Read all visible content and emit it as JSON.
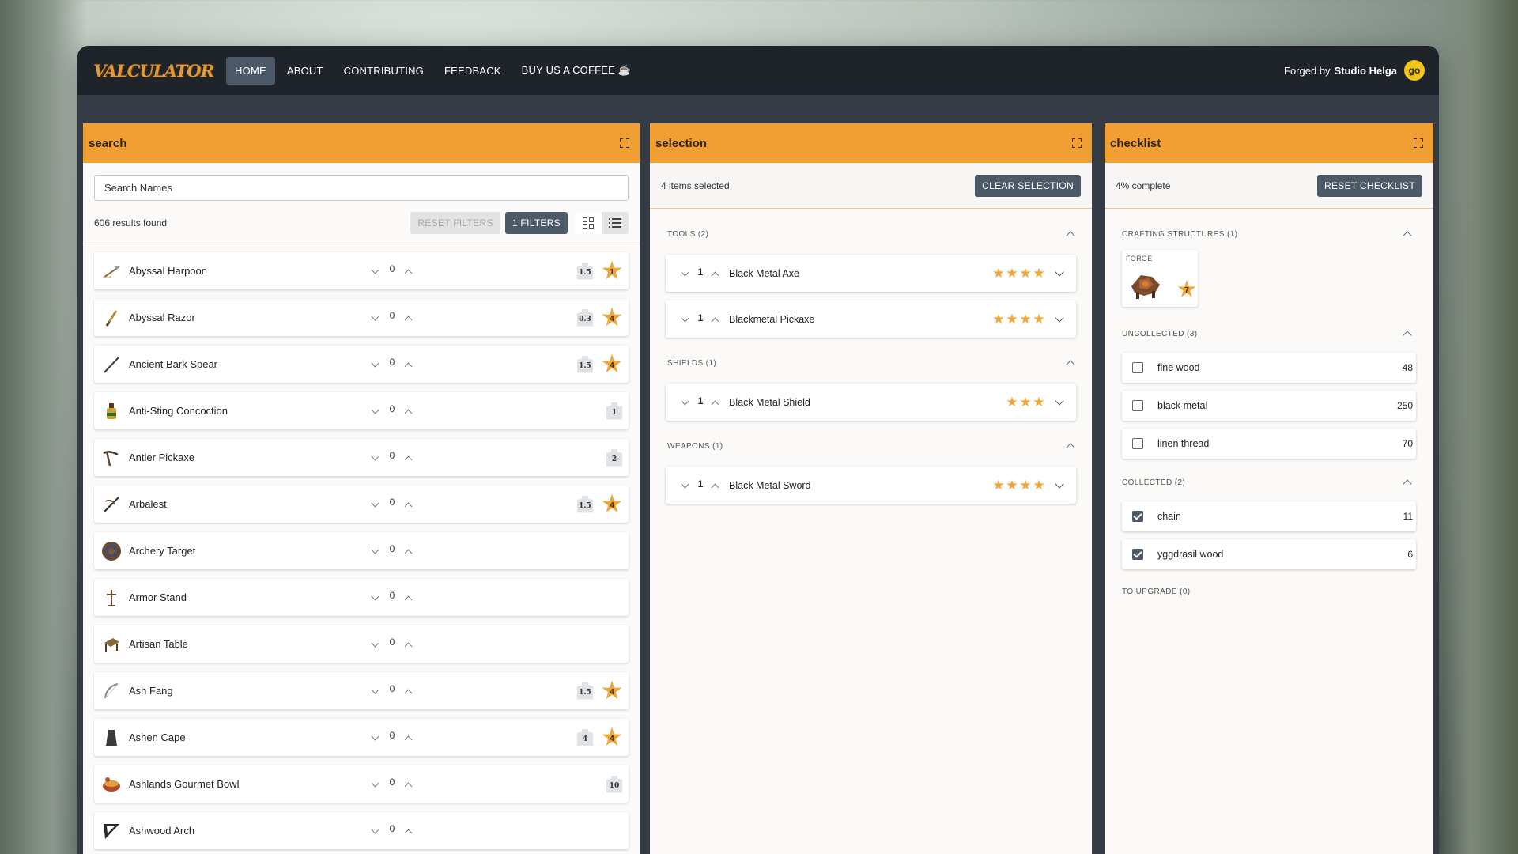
{
  "app": {
    "logo": "VALCULATOR"
  },
  "nav": {
    "items": [
      {
        "label": "HOME",
        "active": true
      },
      {
        "label": "ABOUT",
        "active": false
      },
      {
        "label": "CONTRIBUTING",
        "active": false
      },
      {
        "label": "FEEDBACK",
        "active": false
      },
      {
        "label": "BUY US A COFFEE ☕",
        "active": false
      }
    ],
    "forged_prefix": "Forged by",
    "forged_by": "Studio Helga",
    "badge": "go"
  },
  "search": {
    "title": "search",
    "placeholder": "Search Names",
    "results": "606 results found",
    "reset_filters": "RESET FILTERS",
    "filters": "1 FILTERS",
    "items": [
      {
        "name": "Abyssal Harpoon",
        "qty": "0",
        "weight": "1.5",
        "star": "1",
        "icon": "harpoon-icon"
      },
      {
        "name": "Abyssal Razor",
        "qty": "0",
        "weight": "0.3",
        "star": "4",
        "icon": "razor-icon"
      },
      {
        "name": "Ancient Bark Spear",
        "qty": "0",
        "weight": "1.5",
        "star": "4",
        "icon": "spear-icon"
      },
      {
        "name": "Anti-Sting Concoction",
        "qty": "0",
        "weight": "1",
        "star": "",
        "icon": "potion-icon"
      },
      {
        "name": "Antler Pickaxe",
        "qty": "0",
        "weight": "2",
        "star": "",
        "icon": "pickaxe-icon"
      },
      {
        "name": "Arbalest",
        "qty": "0",
        "weight": "1.5",
        "star": "4",
        "icon": "crossbow-icon"
      },
      {
        "name": "Archery Target",
        "qty": "0",
        "weight": "",
        "star": "",
        "icon": "target-icon"
      },
      {
        "name": "Armor Stand",
        "qty": "0",
        "weight": "",
        "star": "",
        "icon": "armor-stand-icon"
      },
      {
        "name": "Artisan Table",
        "qty": "0",
        "weight": "",
        "star": "",
        "icon": "table-icon"
      },
      {
        "name": "Ash Fang",
        "qty": "0",
        "weight": "1.5",
        "star": "4",
        "icon": "bow-icon"
      },
      {
        "name": "Ashen Cape",
        "qty": "0",
        "weight": "4",
        "star": "4",
        "icon": "cape-icon"
      },
      {
        "name": "Ashlands Gourmet Bowl",
        "qty": "0",
        "weight": "10",
        "star": "",
        "icon": "bowl-icon"
      },
      {
        "name": "Ashwood Arch",
        "qty": "0",
        "weight": "",
        "star": "",
        "icon": "arch-icon"
      }
    ]
  },
  "selection": {
    "title": "selection",
    "count_text": "4 items selected",
    "clear": "CLEAR SELECTION",
    "sections": [
      {
        "label": "TOOLS (2)",
        "items": [
          {
            "qty": "1",
            "name": "Black Metal Axe",
            "stars": 4
          },
          {
            "qty": "1",
            "name": "Blackmetal Pickaxe",
            "stars": 4
          }
        ]
      },
      {
        "label": "SHIELDS (1)",
        "items": [
          {
            "qty": "1",
            "name": "Black Metal Shield",
            "stars": 3
          }
        ]
      },
      {
        "label": "WEAPONS (1)",
        "items": [
          {
            "qty": "1",
            "name": "Black Metal Sword",
            "stars": 4
          }
        ]
      }
    ]
  },
  "checklist": {
    "title": "checklist",
    "progress": "4% complete",
    "reset": "RESET CHECKLIST",
    "crafting_label": "CRAFTING STRUCTURES (1)",
    "forge": {
      "label": "FORGE",
      "level": "7"
    },
    "uncollected_label": "UNCOLLECTED (3)",
    "uncollected": [
      {
        "name": "fine wood",
        "count": "48",
        "checked": false
      },
      {
        "name": "black metal",
        "count": "250",
        "checked": false
      },
      {
        "name": "linen thread",
        "count": "70",
        "checked": false
      }
    ],
    "collected_label": "COLLECTED (2)",
    "collected": [
      {
        "name": "chain",
        "count": "11",
        "checked": true
      },
      {
        "name": "yggdrasil wood",
        "count": "6",
        "checked": true
      }
    ],
    "upgrade_label": "TO UPGRADE (0)"
  },
  "colors": {
    "accent": "#f19f33",
    "button": "#4c5967",
    "nav_bg": "#1f242b"
  }
}
